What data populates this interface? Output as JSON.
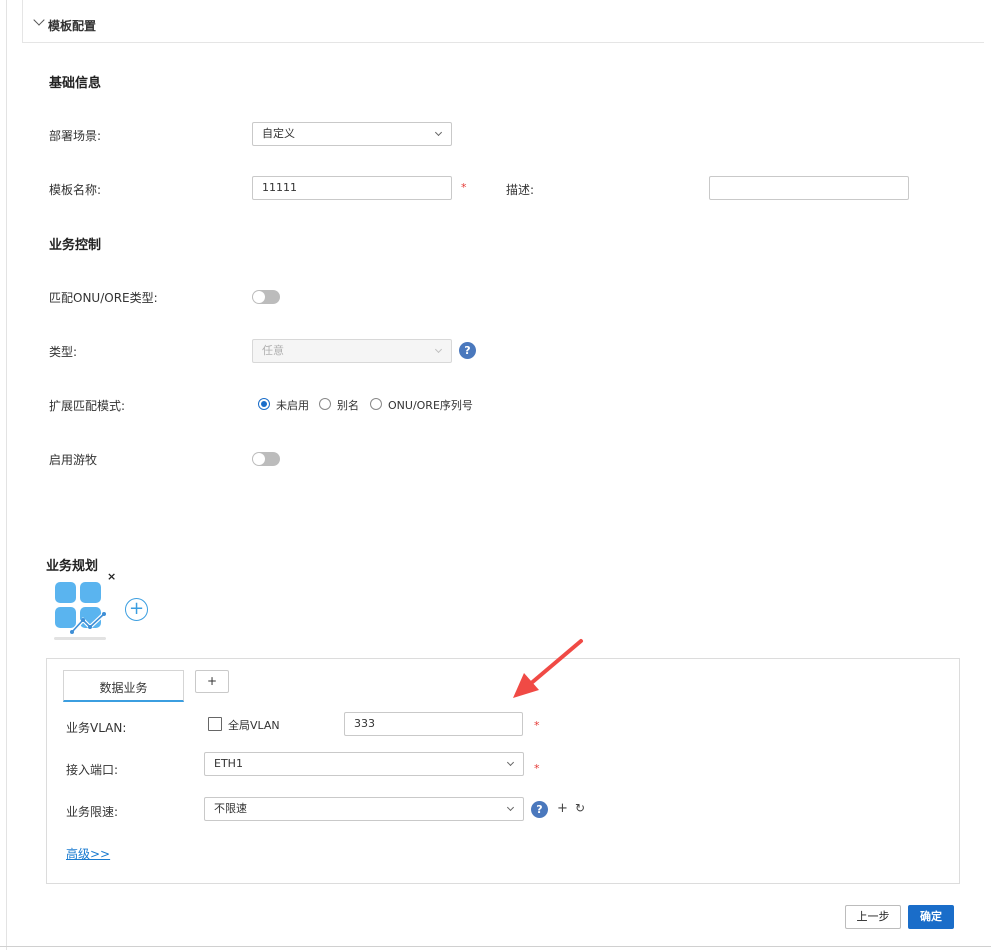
{
  "section": {
    "title": "模板配置"
  },
  "basic": {
    "heading": "基础信息",
    "deploy_label": "部署场景:",
    "deploy_value": "自定义",
    "template_name_label": "模板名称:",
    "template_name_value": "11111",
    "required_mark": "*",
    "desc_label": "描述:",
    "desc_value": ""
  },
  "control": {
    "heading": "业务控制",
    "match_type_label": "匹配ONU/ORE类型:",
    "match_type_enabled": false,
    "type_label": "类型:",
    "type_value": "任意",
    "help_glyph": "?",
    "ext_match_label": "扩展匹配模式:",
    "ext_match_options": [
      "未启用",
      "别名",
      "ONU/ORE序列号"
    ],
    "ext_match_selected": "未启用",
    "roaming_label": "启用游牧",
    "roaming_enabled": false
  },
  "planning": {
    "heading": "业务规划",
    "close_glyph": "×",
    "add_glyph": "+",
    "tab_label": "数据业务",
    "tab_add_label": "+",
    "vlan_label": "业务VLAN:",
    "global_vlan_label": "全局VLAN",
    "global_vlan_checked": false,
    "vlan_value": "333",
    "port_label": "接入端口:",
    "port_value": "ETH1",
    "rate_label": "业务限速:",
    "rate_value": "不限速",
    "rate_add_glyph": "+",
    "rate_refresh_glyph": "↻",
    "advanced_link": "高级>>"
  },
  "footer": {
    "prev_label": "上一步",
    "confirm_label": "确定"
  },
  "colors": {
    "accent": "#1a6dc9",
    "tab_underline": "#3b9ee0",
    "required": "#e53935",
    "help": "#4a78bd",
    "arrow": "#f04a45",
    "icon_tile": "#5ab4ef"
  }
}
